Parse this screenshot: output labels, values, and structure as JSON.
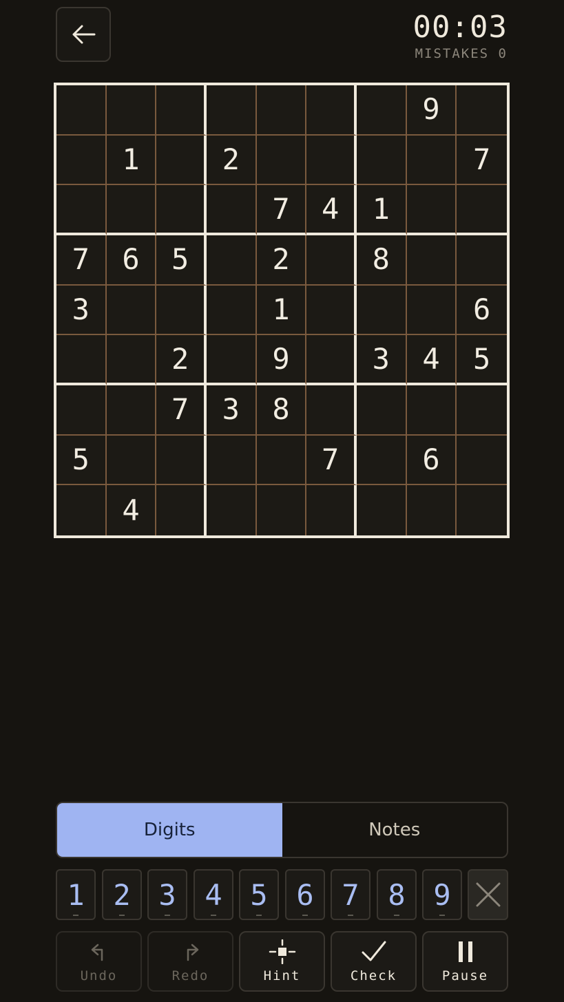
{
  "header": {
    "back_icon": "arrow-left-icon",
    "timer": "00:03",
    "mistakes_label": "MISTAKES",
    "mistakes_count": "0"
  },
  "board": {
    "rows": [
      [
        "",
        "",
        "",
        "",
        "",
        "",
        "",
        "9",
        ""
      ],
      [
        "",
        "1",
        "",
        "2",
        "",
        "",
        "",
        "",
        "7"
      ],
      [
        "",
        "",
        "",
        "",
        "7",
        "4",
        "1",
        "",
        ""
      ],
      [
        "7",
        "6",
        "5",
        "",
        "2",
        "",
        "8",
        "",
        ""
      ],
      [
        "3",
        "",
        "",
        "",
        "1",
        "",
        "",
        "",
        "6"
      ],
      [
        "",
        "",
        "2",
        "",
        "9",
        "",
        "3",
        "4",
        "5"
      ],
      [
        "",
        "",
        "7",
        "3",
        "8",
        "",
        "",
        "",
        ""
      ],
      [
        "5",
        "",
        "",
        "",
        "",
        "7",
        "",
        "6",
        ""
      ],
      [
        "",
        "4",
        "",
        "",
        "",
        "",
        "",
        "",
        ""
      ]
    ]
  },
  "mode": {
    "digits_label": "Digits",
    "notes_label": "Notes",
    "active": "Digits"
  },
  "keypad": {
    "digits": [
      "1",
      "2",
      "3",
      "4",
      "5",
      "6",
      "7",
      "8",
      "9"
    ],
    "clear_icon": "close-icon"
  },
  "actions": {
    "undo_label": "Undo",
    "redo_label": "Redo",
    "hint_label": "Hint",
    "check_label": "Check",
    "pause_label": "Pause",
    "undo_icon": "undo-arrow-icon",
    "redo_icon": "redo-arrow-icon",
    "hint_icon": "crosshair-icon",
    "check_icon": "checkmark-icon",
    "pause_icon": "pause-icon"
  },
  "colors": {
    "background": "#161410",
    "board_border": "#efe9dc",
    "cell_line": "#7a5a3e",
    "accent": "#9fb4f2",
    "digit_key_text": "#a9bdf2"
  }
}
